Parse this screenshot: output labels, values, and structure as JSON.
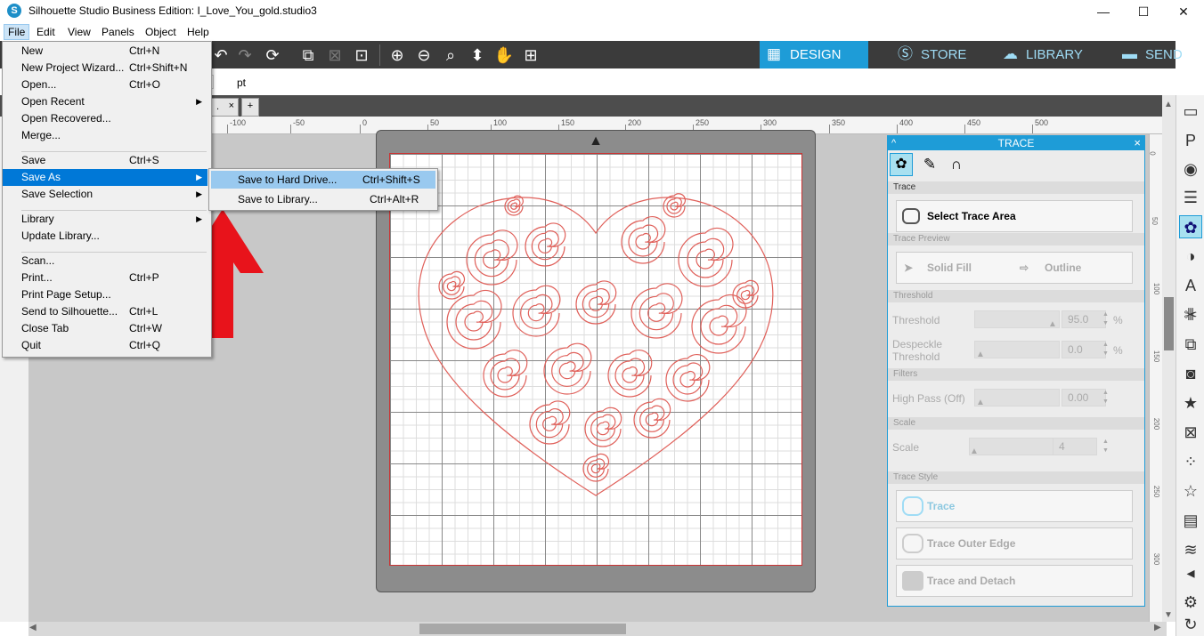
{
  "window": {
    "title": "Silhouette Studio Business Edition: I_Love_You_gold.studio3",
    "logo": "S",
    "minimize": "—",
    "maximize": "☐",
    "close": "✕"
  },
  "menubar": [
    "File",
    "Edit",
    "View",
    "Panels",
    "Object",
    "Help"
  ],
  "nav_tabs": [
    {
      "label": "DESIGN",
      "icon": "grid-icon"
    },
    {
      "label": "STORE",
      "icon": "store-icon"
    },
    {
      "label": "LIBRARY",
      "icon": "cloud-icon"
    },
    {
      "label": "SEND",
      "icon": "cutter-icon"
    }
  ],
  "options_row": {
    "unit": "pt"
  },
  "doc_tabs": {
    "add": "+",
    "close": "×",
    "current_fragment": "."
  },
  "ruler": {
    "labels": [
      "-100",
      "-50",
      "0",
      "50",
      "100",
      "150",
      "200",
      "250",
      "300",
      "350",
      "400",
      "450",
      "500"
    ]
  },
  "vruler": {
    "labels": [
      "0",
      "50",
      "100",
      "150",
      "200",
      "250",
      "300"
    ]
  },
  "file_menu": {
    "items": [
      {
        "label": "New",
        "shortcut": "Ctrl+N"
      },
      {
        "label": "New Project Wizard...",
        "shortcut": "Ctrl+Shift+N"
      },
      {
        "label": "Open...",
        "shortcut": "Ctrl+O"
      },
      {
        "label": "Open Recent",
        "shortcut": "",
        "submenu": true
      },
      {
        "label": "Open Recovered...",
        "shortcut": ""
      },
      {
        "label": "Merge...",
        "shortcut": ""
      },
      {
        "label": "Save",
        "shortcut": "Ctrl+S"
      },
      {
        "label": "Save As",
        "shortcut": "",
        "submenu": true
      },
      {
        "label": "Save Selection",
        "shortcut": "",
        "submenu": true
      },
      {
        "label": "Library",
        "shortcut": "",
        "submenu": true
      },
      {
        "label": "Update Library...",
        "shortcut": ""
      },
      {
        "label": "Scan...",
        "shortcut": ""
      },
      {
        "label": "Print...",
        "shortcut": "Ctrl+P"
      },
      {
        "label": "Print Page Setup...",
        "shortcut": ""
      },
      {
        "label": "Send to Silhouette...",
        "shortcut": "Ctrl+L"
      },
      {
        "label": "Close Tab",
        "shortcut": "Ctrl+W"
      },
      {
        "label": "Quit",
        "shortcut": "Ctrl+Q"
      }
    ]
  },
  "save_as_submenu": {
    "items": [
      {
        "label": "Save to Hard Drive...",
        "shortcut": "Ctrl+Shift+S"
      },
      {
        "label": "Save to Library...",
        "shortcut": "Ctrl+Alt+R"
      }
    ]
  },
  "trace_panel": {
    "title": "TRACE",
    "close": "×",
    "collapse": "^",
    "sec_trace": "Trace",
    "select_area": "Select Trace Area",
    "sec_preview": "Trace Preview",
    "solid_fill": "Solid Fill",
    "outline": "Outline",
    "sec_threshold": "Threshold",
    "threshold_label": "Threshold",
    "threshold_value": "95.0",
    "threshold_unit": "%",
    "despeckle_label_1": "Despeckle",
    "despeckle_label_2": "Threshold",
    "despeckle_value": "0.0",
    "despeckle_unit": "%",
    "sec_filters": "Filters",
    "highpass_label": "High Pass (Off)",
    "highpass_value": "0.00",
    "sec_scale": "Scale",
    "scale_label": "Scale",
    "scale_value": "4",
    "sec_style": "Trace Style",
    "style_trace": "Trace",
    "style_outer": "Trace Outer Edge",
    "style_detach": "Trace and Detach"
  },
  "right_sidebar_icons": [
    "page-icon",
    "pixscan-icon",
    "fill-icon",
    "line-icon",
    "trace-icon",
    "offset-icon",
    "text-icon",
    "align-icon",
    "transform-icon",
    "replicate-icon",
    "modify-icon",
    "star-icon",
    "knife-icon",
    "dots-icon",
    "library-star-icon",
    "sketch-icon",
    "hatch-icon",
    "collapse-icon",
    "settings-icon",
    "refresh-icon"
  ],
  "colors": {
    "accent": "#1e9cd7",
    "toolbar": "#3b3b3b",
    "arrow": "#e8131b",
    "design_lines": "#e0605a"
  }
}
